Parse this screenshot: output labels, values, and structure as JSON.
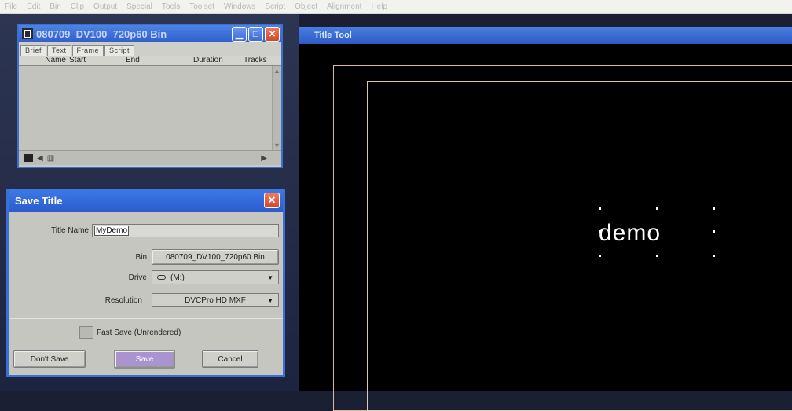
{
  "menubar": {
    "items": [
      "File",
      "Edit",
      "Bin",
      "Clip",
      "Output",
      "Special",
      "Tools",
      "Toolset",
      "Windows",
      "Script",
      "Object",
      "Alignment",
      "Help"
    ]
  },
  "bin_window": {
    "title": "080709_DV100_720p60 Bin",
    "tabs": [
      "Brief",
      "Text",
      "Frame",
      "Script"
    ],
    "columns": [
      "Name",
      "Start",
      "End",
      "Duration",
      "Tracks"
    ],
    "icons": [
      "bin-icon",
      "minimize-icon",
      "maximize-icon",
      "close-icon"
    ]
  },
  "save_title": {
    "title": "Save Title",
    "title_name_label": "Title Name",
    "title_name_value": "MyDemo",
    "bin_label": "Bin",
    "bin_value": "080709_DV100_720p60 Bin",
    "drive_label": "Drive",
    "drive_value": "(M:)",
    "resolution_label": "Resolution",
    "resolution_value": "DVCPro HD MXF",
    "fast_save_label": "Fast Save (Unrendered)",
    "dont_save_label": "Don't Save",
    "save_label": "Save",
    "cancel_label": "Cancel",
    "close_glyph": "✕"
  },
  "title_tool": {
    "title": "Title Tool",
    "text_object": "demo"
  },
  "colors": {
    "accent_blue": "#3a70d6",
    "save_button": "#a994cf",
    "canvas": "#000000"
  }
}
